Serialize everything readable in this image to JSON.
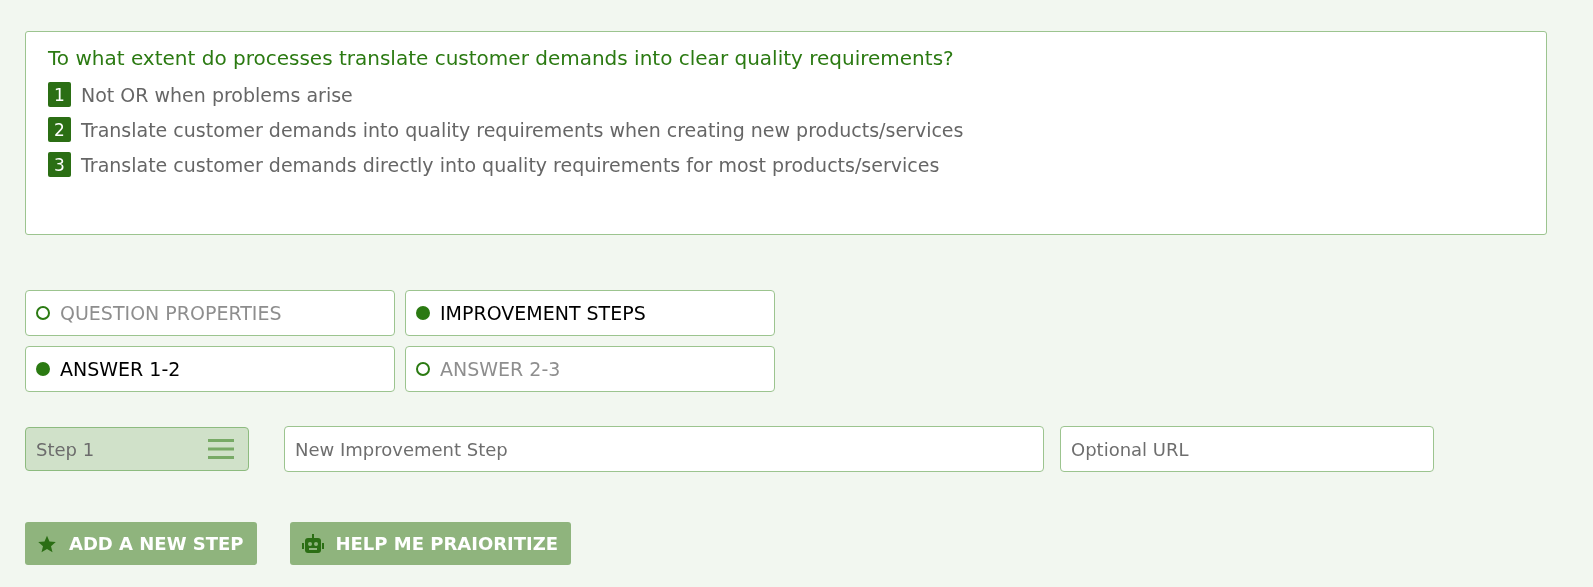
{
  "question": {
    "title": "To what extent do processes translate customer demands into clear quality requirements?",
    "levels": [
      {
        "number": "1",
        "text": "Not OR when problems arise"
      },
      {
        "number": "2",
        "text": "Translate customer demands into quality requirements when creating new products/services"
      },
      {
        "number": "3",
        "text": "Translate customer demands directly into quality requirements for most products/services"
      }
    ]
  },
  "toggles": [
    {
      "label": "QUESTION PROPERTIES",
      "selected": false
    },
    {
      "label": "IMPROVEMENT STEPS",
      "selected": true
    },
    {
      "label": "ANSWER 1-2",
      "selected": true
    },
    {
      "label": "ANSWER 2-3",
      "selected": false
    }
  ],
  "step": {
    "label": "Step 1",
    "name_placeholder": "New Improvement Step",
    "url_placeholder": "Optional URL"
  },
  "buttons": [
    {
      "kind": "add",
      "label": "ADD A NEW STEP"
    },
    {
      "kind": "robot",
      "label": "HELP ME PRAIORITIZE"
    }
  ]
}
